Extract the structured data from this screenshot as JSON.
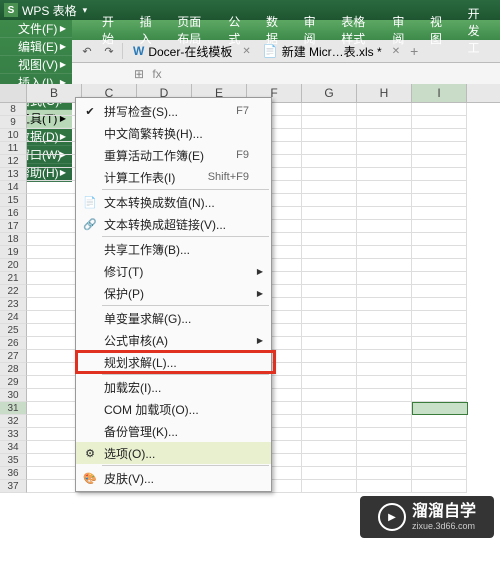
{
  "title": {
    "logo": "S",
    "app": "WPS 表格",
    "dd": "▾"
  },
  "menubar": [
    "开始",
    "插入",
    "页面布局",
    "公式",
    "数据",
    "审阅",
    "表格样式",
    "审阅",
    "视图",
    "开发工"
  ],
  "sidemenu": [
    {
      "label": "文件(F)",
      "tri": true
    },
    {
      "label": "编辑(E)",
      "tri": true
    },
    {
      "label": "视图(V)",
      "tri": true
    },
    {
      "label": "插入(I)",
      "tri": true
    },
    {
      "label": "格式(O)",
      "tri": true
    },
    {
      "label": "工具(T)",
      "tri": true,
      "hl": true
    },
    {
      "label": "数据(D)",
      "tri": true
    },
    {
      "label": "窗口(W)",
      "tri": true
    },
    {
      "label": "帮助(H)",
      "tri": true
    }
  ],
  "toolbar": {
    "undo": "↶",
    "redo": "↷",
    "doc1_icon": "W",
    "doc1": "Docer-在线模板",
    "x1": "✕",
    "doc2_icon": "📄",
    "doc2": "新建 Micr…表.xls *",
    "x2": "✕",
    "plus": "+"
  },
  "formula": {
    "cell": "",
    "ico1": "⊞",
    "ico2": "fx"
  },
  "cols": [
    "B",
    "C",
    "D",
    "E",
    "F",
    "G",
    "H",
    "I"
  ],
  "rows_start": 8,
  "rows_end": 37,
  "sel_row": 31,
  "sel_col": "I",
  "ctx": [
    {
      "t": "item",
      "ico": "✔",
      "label": "拼写检查(S)...",
      "sc": "F7"
    },
    {
      "t": "item",
      "label": "中文简繁转换(H)..."
    },
    {
      "t": "item",
      "label": "重算活动工作簿(E)",
      "sc": "F9"
    },
    {
      "t": "item",
      "label": "计算工作表(I)",
      "sc": "Shift+F9"
    },
    {
      "t": "sep"
    },
    {
      "t": "item",
      "ico": "📄",
      "label": "文本转换成数值(N)..."
    },
    {
      "t": "item",
      "ico": "🔗",
      "label": "文本转换成超链接(V)..."
    },
    {
      "t": "sep"
    },
    {
      "t": "item",
      "label": "共享工作簿(B)..."
    },
    {
      "t": "item",
      "label": "修订(T)",
      "tri": true
    },
    {
      "t": "item",
      "label": "保护(P)",
      "tri": true
    },
    {
      "t": "sep"
    },
    {
      "t": "item",
      "label": "单变量求解(G)..."
    },
    {
      "t": "item",
      "label": "公式审核(A)",
      "tri": true
    },
    {
      "t": "item",
      "label": "规划求解(L)..."
    },
    {
      "t": "sep"
    },
    {
      "t": "item",
      "label": "加载宏(I)..."
    },
    {
      "t": "item",
      "label": "COM 加载项(O)..."
    },
    {
      "t": "item",
      "label": "备份管理(K)..."
    },
    {
      "t": "item",
      "ico": "⚙",
      "label": "选项(O)...",
      "hl": true
    },
    {
      "t": "sep"
    },
    {
      "t": "item",
      "ico": "🎨",
      "label": "皮肤(V)..."
    }
  ],
  "wm": {
    "play": "▶",
    "big": "溜溜自学",
    "small": "zixue.3d66.com"
  }
}
